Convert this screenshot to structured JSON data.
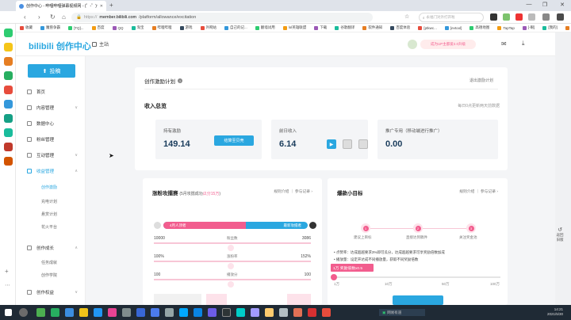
{
  "browser": {
    "tab_title": "创作中心 - 哔哩哔哩弹幕视频网 - (゜-゜)つ",
    "url_prefix": "https://",
    "url_host": "member.bilibili.com",
    "url_path": "/platform/allowance/excitation",
    "search_placeholder": "永福门对外打开啦"
  },
  "bookmarks": [
    "收藏",
    "魔兽争霸",
    "[TQ]...",
    "百度",
    "QQ",
    "淘宝",
    "哔哩哔哩",
    "游戏",
    "外网站",
    "自己的记...",
    "翻墙试用",
    "lol英雄联盟",
    "下载",
    "谷歌翻译",
    "软件通知",
    "百度体验",
    "[ptkwc...",
    "[evtool]",
    "高德地图",
    "TapTap",
    "[-眼]",
    "[我的]",
    "我的."
  ],
  "header": {
    "logo_mark": "bilibili",
    "logo_text": "创作中心",
    "home_label": "主站",
    "up_promo": "成为UP主都爱2.0升级"
  },
  "nav": {
    "upload": "投稿",
    "items": [
      {
        "label": "首页"
      },
      {
        "label": "内容管理",
        "chevron": "∨"
      },
      {
        "label": "数据中心"
      },
      {
        "label": "粉丝管理"
      },
      {
        "label": "互动管理",
        "chevron": "∨"
      },
      {
        "label": "收益管理",
        "chevron": "∧"
      }
    ],
    "sub_items": [
      "创作激励",
      "充电计划",
      "悬赏计划",
      "花火平台"
    ],
    "items2": [
      {
        "label": "创作成长",
        "chevron": "∧"
      }
    ],
    "sub_items2": [
      "任务成就",
      "创作学院"
    ],
    "items3": [
      {
        "label": "创作权益",
        "chevron": "∨"
      }
    ]
  },
  "incentive": {
    "title": "创作激励计划",
    "exit_label": "退出激励计划",
    "revenue_title": "收入总览",
    "update_note": "每日0点更新两天前数据",
    "balance_label": "持有激励",
    "balance_value": "149.14",
    "withdraw_label": "结算至贝壳",
    "yesterday_label": "前日收入",
    "yesterday_value": "6.14",
    "promo_label": "推广专用（移动端进行推广）",
    "promo_value": "0.00"
  },
  "fans_panel": {
    "title": "涨粉攻擂赛",
    "subtitle_a": "(5月攻擂成功",
    "subtitle_b": "瓜分15万",
    "subtitle_c": ")",
    "links": "规则介绍 ｜ 参与记录 ›",
    "banner_left": "4月人顶者",
    "banner_right": "最新攻擂者",
    "rows": [
      {
        "left": "10000",
        "mid": "粉丝数",
        "right": "3086"
      },
      {
        "left": "100%",
        "mid": "涨粉率",
        "right": "152%"
      },
      {
        "left": "100",
        "mid": "播放分",
        "right": "100"
      }
    ],
    "percent_left": 57,
    "percent_right": 43
  },
  "hit_panel": {
    "title": "爆款小目标",
    "links": "规则介绍 ｜ 参与记录 ›",
    "steps": [
      "建议上目标",
      "直接达到稿件",
      "关注奖金池"
    ],
    "note1": "• 点赞率：达成超越要求3%即可瓜分，达成超越要求可享奖励倍数加成",
    "note2": "• 播放量：设定开达成不同播放量，获取不同奖励倍数",
    "tip": "1万 奖励倍数x0.5",
    "scale": [
      "1万",
      "10万",
      "50万",
      "100万"
    ],
    "progress_fraction": 0.0
  },
  "side_float": {
    "back_old": "返回旧版"
  },
  "taskbar": {
    "ime": "网易有道",
    "time": "2021/5/30",
    "clock": "14:21"
  },
  "colors": {
    "accent": "#2aa7e0",
    "pink": "#f25d8e",
    "dark": "#1a3c5c"
  }
}
